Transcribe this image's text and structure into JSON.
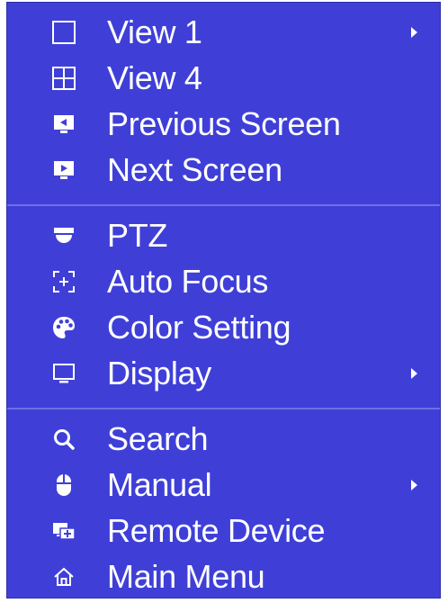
{
  "menu": {
    "groups": [
      {
        "items": [
          {
            "label": "View 1",
            "icon": "view-1-icon",
            "submenu": true
          },
          {
            "label": "View 4",
            "icon": "view-4-icon",
            "submenu": false
          },
          {
            "label": "Previous Screen",
            "icon": "previous-screen-icon",
            "submenu": false
          },
          {
            "label": "Next Screen",
            "icon": "next-screen-icon",
            "submenu": false
          }
        ]
      },
      {
        "items": [
          {
            "label": "PTZ",
            "icon": "ptz-camera-icon",
            "submenu": false
          },
          {
            "label": "Auto Focus",
            "icon": "auto-focus-icon",
            "submenu": false
          },
          {
            "label": "Color Setting",
            "icon": "palette-icon",
            "submenu": false
          },
          {
            "label": "Display",
            "icon": "monitor-icon",
            "submenu": true
          }
        ]
      },
      {
        "items": [
          {
            "label": "Search",
            "icon": "search-icon",
            "submenu": false
          },
          {
            "label": "Manual",
            "icon": "mouse-icon",
            "submenu": true
          },
          {
            "label": "Remote Device",
            "icon": "remote-device-icon",
            "submenu": false
          },
          {
            "label": "Main Menu",
            "icon": "home-icon",
            "submenu": false
          }
        ]
      }
    ]
  },
  "colors": {
    "background": "#3f3fd8",
    "text": "#ffffff",
    "divider": "#6f6fe6"
  }
}
